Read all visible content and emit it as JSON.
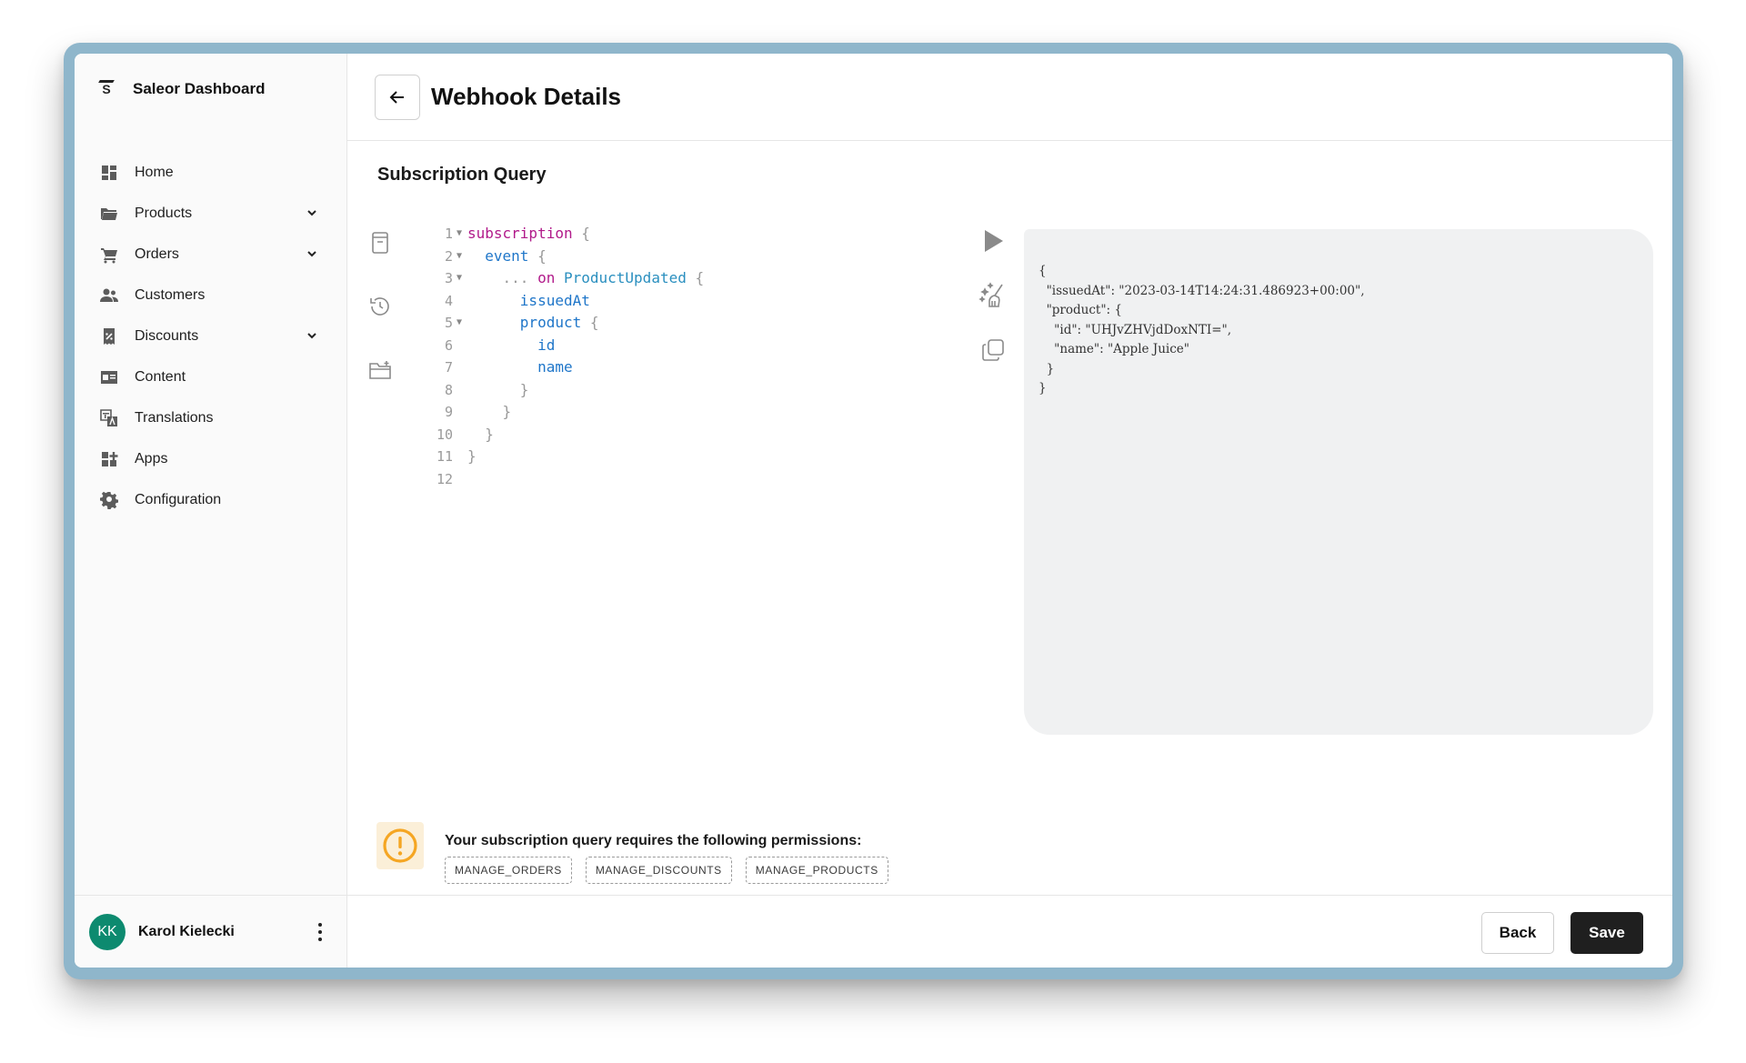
{
  "app": {
    "name": "Saleor Dashboard"
  },
  "sidebar": {
    "items": [
      {
        "label": "Home",
        "icon": "home-icon",
        "expandable": false
      },
      {
        "label": "Products",
        "icon": "folder-icon",
        "expandable": true
      },
      {
        "label": "Orders",
        "icon": "cart-icon",
        "expandable": true
      },
      {
        "label": "Customers",
        "icon": "people-icon",
        "expandable": false
      },
      {
        "label": "Discounts",
        "icon": "discount-icon",
        "expandable": true
      },
      {
        "label": "Content",
        "icon": "content-icon",
        "expandable": false
      },
      {
        "label": "Translations",
        "icon": "translate-icon",
        "expandable": false
      },
      {
        "label": "Apps",
        "icon": "apps-icon",
        "expandable": false
      },
      {
        "label": "Configuration",
        "icon": "gear-icon",
        "expandable": false
      }
    ]
  },
  "user": {
    "initials": "KK",
    "name": "Karol Kielecki"
  },
  "header": {
    "title": "Webhook Details"
  },
  "editor": {
    "section_title": "Subscription Query",
    "lines": [
      {
        "n": "1",
        "fold": true
      },
      {
        "n": "2",
        "fold": true
      },
      {
        "n": "3",
        "fold": true
      },
      {
        "n": "4",
        "fold": false
      },
      {
        "n": "5",
        "fold": true
      },
      {
        "n": "6",
        "fold": false
      },
      {
        "n": "7",
        "fold": false
      },
      {
        "n": "8",
        "fold": false
      },
      {
        "n": "9",
        "fold": false
      },
      {
        "n": "10",
        "fold": false
      },
      {
        "n": "11",
        "fold": false
      },
      {
        "n": "12",
        "fold": false
      }
    ],
    "tokens": {
      "subscription": "subscription",
      "event": "event",
      "spread": "...",
      "on": "on",
      "type": "ProductUpdated",
      "issuedAt": "issuedAt",
      "product": "product",
      "id": "id",
      "name": "name",
      "open_brace": "{",
      "close_brace": "}"
    }
  },
  "result": {
    "json": "{\n  \"issuedAt\": \"2023-03-14T14:24:31.486923+00:00\",\n  \"product\": {\n    \"id\": \"UHJvZHVjdDoxNTI=\",\n    \"name\": \"Apple Juice\"\n  }\n}"
  },
  "permissions": {
    "message": "Your subscription query requires the following permissions:",
    "badges": [
      "MANAGE_ORDERS",
      "MANAGE_DISCOUNTS",
      "MANAGE_PRODUCTS"
    ]
  },
  "footer": {
    "back_label": "Back",
    "save_label": "Save"
  },
  "colors": {
    "accent_dark": "#1f1f1f",
    "avatar": "#0d8a6f",
    "warning": "#f5a623",
    "frame": "#8fb6cb"
  }
}
